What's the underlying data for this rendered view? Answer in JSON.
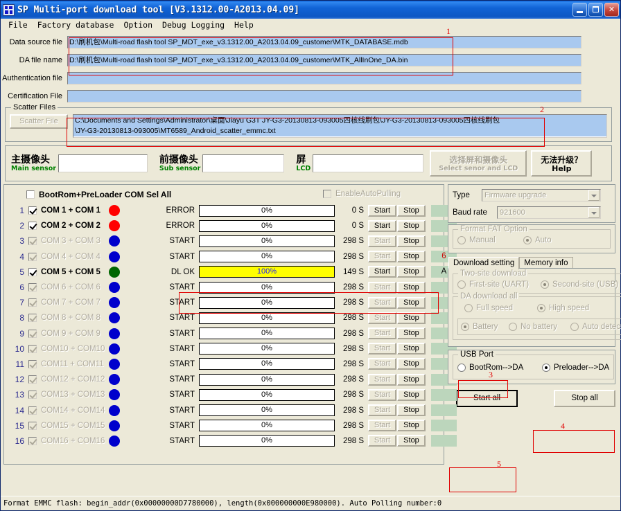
{
  "window": {
    "title": "SP Multi-port download tool [V3.1312.00-A2013.04.09]",
    "minimize_label": "",
    "maximize_label": "",
    "close_label": "✕"
  },
  "menu": [
    "File",
    "Factory database",
    "Option",
    "Debug Logging",
    "Help"
  ],
  "files": [
    {
      "label": "Data source file",
      "value": "D:\\刷机包\\Multi-road flash tool SP_MDT_exe_v3.1312.00_A2013.04.09_customer\\MTK_DATABASE.mdb"
    },
    {
      "label": "DA file name",
      "value": "D:\\刷机包\\Multi-road flash tool SP_MDT_exe_v3.1312.00_A2013.04.09_customer\\MTK_AllInOne_DA.bin"
    },
    {
      "label": "Authentication file",
      "value": ""
    },
    {
      "label": "Certification File",
      "value": ""
    }
  ],
  "scatter": {
    "legend": "Scatter Files",
    "button": "Scatter File",
    "line1": "C:\\Documents and Settings\\Administrator\\桌面\\Jiayu G3T JY-G3-20130813-093005四核线刷包\\JY-G3-20130813-093005四核线刷包",
    "line2": "\\JY-G3-20130813-093005\\MT6589_Android_scatter_emmc.txt"
  },
  "sensor": {
    "main_cn": "主摄像头",
    "main_en": "Main sensor",
    "main_value": "",
    "sub_cn": "前摄像头",
    "sub_en": "Sub sensor",
    "sub_value": "",
    "lcd_cn": "屏",
    "lcd_en": "LCD",
    "lcd_value": "",
    "select_cn": "选择屏和摄像头",
    "select_en": "Select senor and LCD",
    "help_cn": "无法升级？",
    "help_en": "Help"
  },
  "comlist": {
    "sel_all_label": "BootRom+PreLoader COM Sel All",
    "sel_all_checked": false,
    "autopulling_label": "EnableAutoPulling",
    "autopulling_checked": false,
    "start_label": "Start",
    "stop_label": "Stop",
    "rows": [
      {
        "n": "1",
        "com": "COM 1 + COM 1",
        "checked": true,
        "enabled": true,
        "led": "#ff0000",
        "status": "ERROR",
        "pct": "0%",
        "full": false,
        "secs": "0 S",
        "tag": ""
      },
      {
        "n": "2",
        "com": "COM 2 + COM 2",
        "checked": true,
        "enabled": true,
        "led": "#ff0000",
        "status": "ERROR",
        "pct": "0%",
        "full": false,
        "secs": "0 S",
        "tag": ""
      },
      {
        "n": "3",
        "com": "COM 3 + COM 3",
        "checked": true,
        "enabled": false,
        "led": "#0000cc",
        "status": "START",
        "pct": "0%",
        "full": false,
        "secs": "298 S",
        "tag": ""
      },
      {
        "n": "4",
        "com": "COM 4 + COM 4",
        "checked": true,
        "enabled": false,
        "led": "#0000cc",
        "status": "START",
        "pct": "0%",
        "full": false,
        "secs": "298 S",
        "tag": "6"
      },
      {
        "n": "5",
        "com": "COM 5 + COM 5",
        "checked": true,
        "enabled": true,
        "led": "#006600",
        "status": "DL OK",
        "pct": "100%",
        "full": true,
        "secs": "149 S",
        "tag": "A"
      },
      {
        "n": "6",
        "com": "COM 6 + COM 6",
        "checked": true,
        "enabled": false,
        "led": "#0000cc",
        "status": "START",
        "pct": "0%",
        "full": false,
        "secs": "298 S",
        "tag": ""
      },
      {
        "n": "7",
        "com": "COM 7 + COM 7",
        "checked": true,
        "enabled": false,
        "led": "#0000cc",
        "status": "START",
        "pct": "0%",
        "full": false,
        "secs": "298 S",
        "tag": ""
      },
      {
        "n": "8",
        "com": "COM 8 + COM 8",
        "checked": true,
        "enabled": false,
        "led": "#0000cc",
        "status": "START",
        "pct": "0%",
        "full": false,
        "secs": "298 S",
        "tag": ""
      },
      {
        "n": "9",
        "com": "COM 9 + COM 9",
        "checked": true,
        "enabled": false,
        "led": "#0000cc",
        "status": "START",
        "pct": "0%",
        "full": false,
        "secs": "298 S",
        "tag": ""
      },
      {
        "n": "10",
        "com": "COM10 + COM10",
        "checked": true,
        "enabled": false,
        "led": "#0000cc",
        "status": "START",
        "pct": "0%",
        "full": false,
        "secs": "298 S",
        "tag": ""
      },
      {
        "n": "11",
        "com": "COM11 + COM11",
        "checked": true,
        "enabled": false,
        "led": "#0000cc",
        "status": "START",
        "pct": "0%",
        "full": false,
        "secs": "298 S",
        "tag": ""
      },
      {
        "n": "12",
        "com": "COM12 + COM12",
        "checked": true,
        "enabled": false,
        "led": "#0000cc",
        "status": "START",
        "pct": "0%",
        "full": false,
        "secs": "298 S",
        "tag": ""
      },
      {
        "n": "13",
        "com": "COM13 + COM13",
        "checked": true,
        "enabled": false,
        "led": "#0000cc",
        "status": "START",
        "pct": "0%",
        "full": false,
        "secs": "298 S",
        "tag": ""
      },
      {
        "n": "14",
        "com": "COM14 + COM14",
        "checked": true,
        "enabled": false,
        "led": "#0000cc",
        "status": "START",
        "pct": "0%",
        "full": false,
        "secs": "298 S",
        "tag": ""
      },
      {
        "n": "15",
        "com": "COM15 + COM15",
        "checked": true,
        "enabled": false,
        "led": "#0000cc",
        "status": "START",
        "pct": "0%",
        "full": false,
        "secs": "298 S",
        "tag": ""
      },
      {
        "n": "16",
        "com": "COM16 + COM16",
        "checked": true,
        "enabled": false,
        "led": "#0000cc",
        "status": "START",
        "pct": "0%",
        "full": false,
        "secs": "298 S",
        "tag": ""
      }
    ]
  },
  "settings": {
    "type_label": "Type",
    "type_value": "Firmware upgrade",
    "baud_label": "Baud rate",
    "baud_value": "921600",
    "format_fat_legend": "Format FAT Option",
    "format_manual": "Manual",
    "format_auto": "Auto",
    "tabs": [
      {
        "label": "Download setting",
        "active": true
      },
      {
        "label": "Memory info",
        "active": false
      }
    ],
    "two_site_legend": "Two-site download",
    "two_site_first": "First-site (UART)",
    "two_site_second": "Second-site (USB)",
    "da_legend": "DA download all",
    "da_full": "Full speed",
    "da_high": "High speed",
    "battery": "Battery",
    "no_battery": "No battery",
    "auto_detect": "Auto detect",
    "usb_legend": "USB Port",
    "usb_bootrom": "BootRom-->DA",
    "usb_preloader": "Preloader-->DA",
    "start_all": "Start all",
    "stop_all": "Stop all"
  },
  "statusbar": {
    "text": "Format EMMC flash:  begin_addr(0x00000000D7780000), length(0x000000000E980000). Auto Polling number:0"
  },
  "annotations": [
    {
      "num": "1"
    },
    {
      "num": "2"
    },
    {
      "num": "3"
    },
    {
      "num": "4"
    },
    {
      "num": "5"
    },
    {
      "num": "6"
    }
  ],
  "colors": {
    "accent": "#0a5fd4",
    "led_error": "#ff0000",
    "led_idle": "#0000cc",
    "led_ok": "#006600",
    "progress_full": "#ffff00",
    "annotation": "#e00000"
  }
}
